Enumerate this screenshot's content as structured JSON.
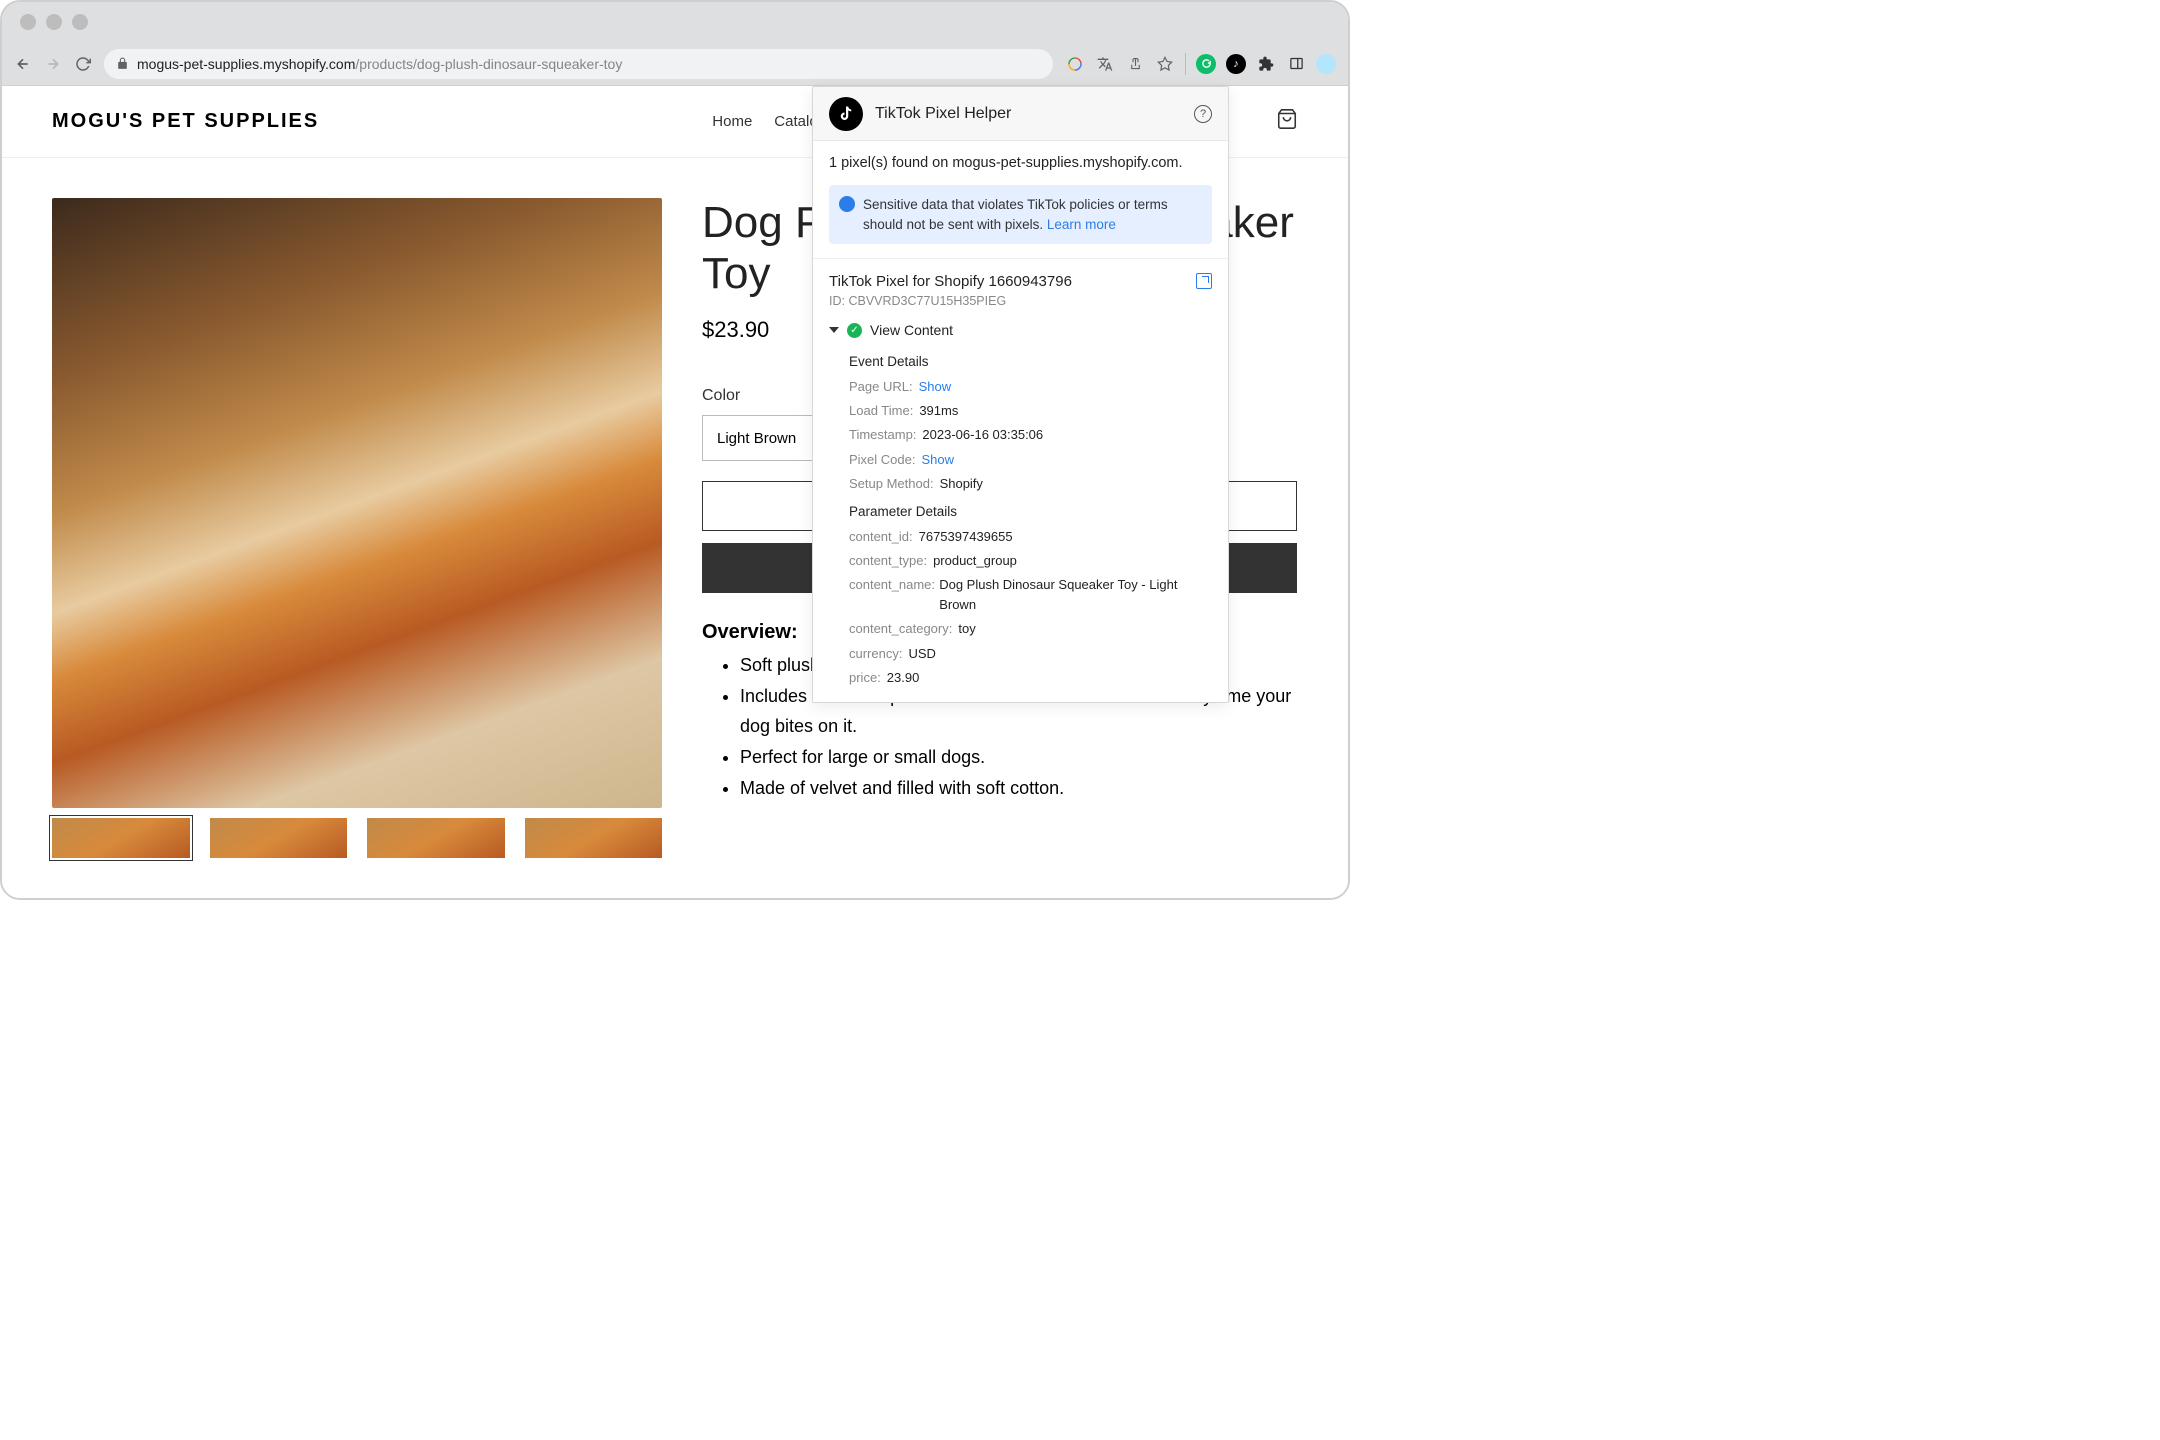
{
  "browser": {
    "url_domain": "mogus-pet-supplies.myshopify.com",
    "url_path": "/products/dog-plush-dinosaur-squeaker-toy"
  },
  "site": {
    "brand": "MOGU'S PET SUPPLIES",
    "nav": {
      "home": "Home",
      "catalog": "Catalog"
    }
  },
  "product": {
    "title": "Dog Plush Dinosaur Squeaker Toy",
    "price": "$23.90",
    "option_label": "Color",
    "option_value": "Light Brown",
    "overview_heading": "Overview:",
    "bullets": [
      "Soft plush dog toy.",
      "Includes a noise squeaker inside that makes a sound every time your dog bites on it.",
      "Perfect for large or small dogs.",
      "Made of velvet and filled with soft cotton."
    ]
  },
  "ext": {
    "title": "TikTok Pixel Helper",
    "found": "1 pixel(s) found on mogus-pet-supplies.myshopify.com.",
    "alert": "Sensitive data that violates TikTok policies or terms should not be sent with pixels. ",
    "alert_link": "Learn more",
    "pixel_title": "TikTok Pixel for Shopify 1660943796",
    "pixel_id_label": "ID:",
    "pixel_id": "CBVVRD3C77U15H35PIEG",
    "event_name": "View Content",
    "event_details_h": "Event Details",
    "details": {
      "page_url_k": "Page URL:",
      "page_url_v": "Show",
      "load_time_k": "Load Time:",
      "load_time_v": "391ms",
      "timestamp_k": "Timestamp:",
      "timestamp_v": "2023-06-16 03:35:06",
      "pixel_code_k": "Pixel Code:",
      "pixel_code_v": "Show",
      "setup_k": "Setup Method:",
      "setup_v": "Shopify"
    },
    "param_h": "Parameter Details",
    "params": {
      "content_id_k": "content_id:",
      "content_id_v": "7675397439655",
      "content_type_k": "content_type:",
      "content_type_v": "product_group",
      "content_name_k": "content_name:",
      "content_name_v": "Dog Plush Dinosaur Squeaker Toy - Light Brown",
      "content_category_k": "content_category:",
      "content_category_v": "toy",
      "currency_k": "currency:",
      "currency_v": "USD",
      "price_k": "price:",
      "price_v": "23.90"
    }
  }
}
